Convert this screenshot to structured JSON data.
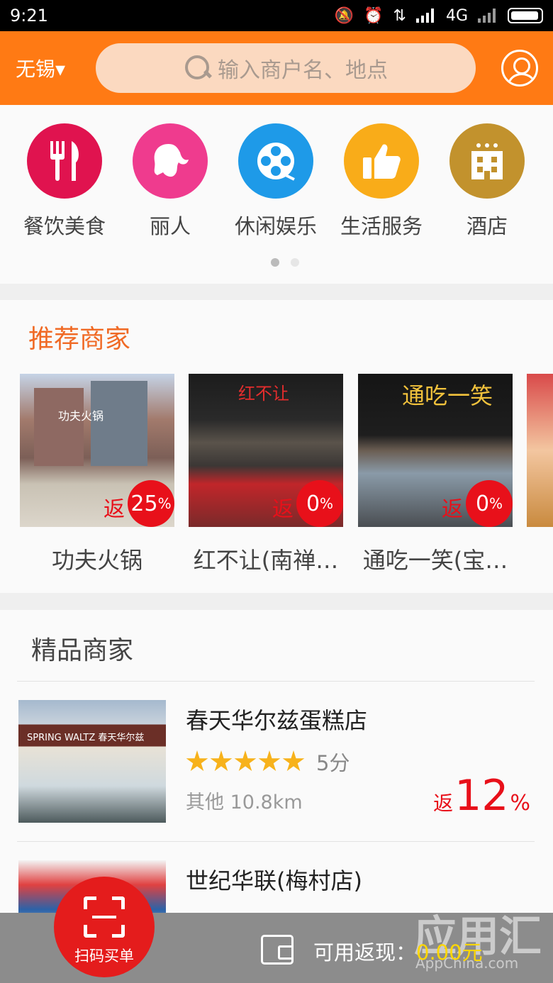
{
  "status": {
    "time": "9:21",
    "network": "4G"
  },
  "header": {
    "city": "无锡▾",
    "search_placeholder": "输入商户名、地点"
  },
  "categories": [
    {
      "label": "餐饮美食",
      "icon": "fork-knife-icon",
      "color": "#e0134f"
    },
    {
      "label": "丽人",
      "icon": "woman-icon",
      "color": "#ef3b8e"
    },
    {
      "label": "休闲娱乐",
      "icon": "film-reel-icon",
      "color": "#1e9ae8"
    },
    {
      "label": "生活服务",
      "icon": "thumbs-up-icon",
      "color": "#f9ac19"
    },
    {
      "label": "酒店",
      "icon": "hotel-icon",
      "color": "#c2922d"
    }
  ],
  "recommend": {
    "title": "推荐商家",
    "rebate_word": "返",
    "items": [
      {
        "name": "功夫火锅",
        "rebate": "25",
        "unit": "%",
        "sign": "功夫火锅"
      },
      {
        "name": "红不让(南禅…",
        "rebate": "0",
        "unit": "%",
        "sign": "红不让"
      },
      {
        "name": "通吃一笑(宝…",
        "rebate": "0",
        "unit": "%",
        "sign": "通吃一笑"
      }
    ]
  },
  "quality": {
    "title": "精品商家",
    "items": [
      {
        "name": "春天华尔兹蛋糕店",
        "score": "5分",
        "meta": "其他 10.8km",
        "rebate_word": "返",
        "rebate": "12",
        "unit": "%",
        "sign": "SPRING WALTZ 春天华尔兹",
        "stars": 5
      },
      {
        "name": "世纪华联(梅村店)"
      }
    ]
  },
  "bottom": {
    "scan_label": "扫码买单",
    "cash_label": "可用返现：",
    "cash_value": "0.00元"
  },
  "watermark": {
    "text": "应用汇",
    "sub": "AppChina.com"
  }
}
